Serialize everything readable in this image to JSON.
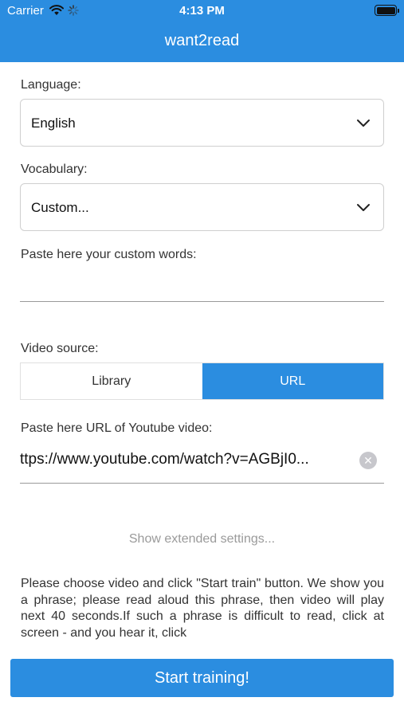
{
  "status_bar": {
    "carrier": "Carrier",
    "time": "4:13 PM",
    "wifi_icon": "wifi-icon",
    "activity_icon": "activity-spinner-icon",
    "battery_icon": "battery-icon"
  },
  "nav": {
    "title": "want2read",
    "background_color": "#2b8de0"
  },
  "form": {
    "language": {
      "label": "Language:",
      "selected": "English",
      "icon": "chevron-down-icon"
    },
    "vocabulary": {
      "label": "Vocabulary:",
      "selected": "Custom...",
      "icon": "chevron-down-icon"
    },
    "custom_words": {
      "label": "Paste here your custom words:",
      "value": ""
    },
    "video_source": {
      "label": "Video source:",
      "options": [
        "Library",
        "URL"
      ],
      "selected": "URL",
      "active_color": "#2b8de0"
    },
    "youtube_url": {
      "label": "Paste here URL of Youtube video:",
      "value": "ttps://www.youtube.com/watch?v=AGBjI0...",
      "clear_icon": "clear-icon"
    }
  },
  "extended_settings_link": "Show extended settings...",
  "description": "Please choose video and click \"Start train\" button. We show you a phrase; please read aloud this phrase, then video will play next 40 seconds.If such a phrase is difficult to read, click at screen - and you hear it, click",
  "start_button": "Start training!"
}
